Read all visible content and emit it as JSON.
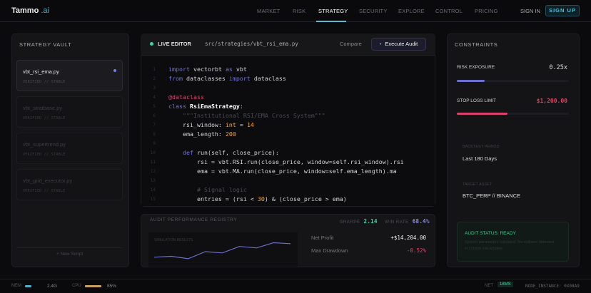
{
  "header": {
    "logo": "Tammo",
    "logo_suffix": ".ai",
    "nav": [
      "MARKET",
      "RISK",
      "STRATEGY",
      "SECURITY",
      "EXPLORE",
      "CONTROL",
      "PRICING"
    ],
    "active_nav": "STRATEGY",
    "sign_in": "SIGN IN",
    "sign_up": "SIGN UP"
  },
  "vault": {
    "title": "STRATEGY VAULT",
    "items": [
      {
        "name": "vbt_rsi_ema.py",
        "status": "VERIFIED // STABLE"
      },
      {
        "name": "vbt_stratbase.py",
        "status": "VERIFIED // STABLE"
      },
      {
        "name": "vbt_supertrend.py",
        "status": "VERIFIED // STABLE"
      },
      {
        "name": "vbt_grid_executor.py",
        "status": "VERIFIED // STABLE"
      }
    ],
    "new_script": "+ New Script"
  },
  "editor": {
    "label": "LIVE EDITOR",
    "path": "src/strategies/vbt_rsi_ema.py",
    "compare": "Compare",
    "execute": "Execute Audit",
    "line_numbers": [
      "1",
      "2",
      "3",
      "4",
      "5",
      "6",
      "7",
      "8",
      "9",
      "10",
      "11",
      "12",
      "13",
      "14",
      "15"
    ]
  },
  "audit": {
    "title": "AUDIT PERFORMANCE REGISTRY",
    "sharpe_label": "SHARPE",
    "sharpe": "2.14",
    "winrate_label": "WIN RATE",
    "winrate": "68.4%",
    "sim_label": "SIMULATION RESULTS",
    "sparkline": [
      0.2,
      0.25,
      0.12,
      0.5,
      0.43,
      0.78,
      0.7,
      0.98,
      0.93
    ],
    "net_profit_label": "Net Profit",
    "net_profit": "+$14,204.00",
    "drawdown_label": "Max Drawdown",
    "drawdown": "-0.52%"
  },
  "constraints": {
    "title": "CONSTRAINTS",
    "risk_label": "RISK EXPOSURE",
    "risk_value": "0.25x",
    "risk_fill": 0.25,
    "stop_label": "STOP LOSS LIMIT",
    "stop_value": "$1,200.00",
    "stop_fill": 0.45,
    "backtest_label": "BACKTEST PERIOD",
    "backtest_value": "Last 180 Days",
    "asset_label": "TARGET ASSET",
    "asset_value": "BTC_PERP // BINANCE",
    "status_title": "AUDIT STATUS: READY",
    "status_text": "System parameters validated. No collision detected in current risk window."
  },
  "footer": {
    "mem_label": "MEM",
    "mem": "2.4G",
    "cpu_label": "CPU",
    "cpu": "85%",
    "net_label": "NET",
    "net": "18MS",
    "node": "NODE_INSTANCE: 0X08A9"
  },
  "colors": {
    "accent": "#5fb6cf",
    "indigo": "#7a7fe0",
    "danger": "#e0445f",
    "success": "#3fd4a0"
  }
}
